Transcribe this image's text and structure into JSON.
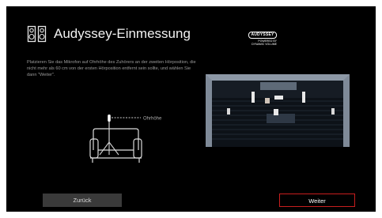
{
  "header": {
    "title": "Audyssey-Einmessung",
    "title_icon": "speaker-pair-icon"
  },
  "logo": {
    "brand": "AUDYSSEY",
    "line1": "POWERED BY",
    "line2": "DYNAMIC VOLUME"
  },
  "instruction": "Platzieren Sie das Mikrofon auf Ohrhöhe des Zuhörers an der zweiten Hörposition, die nicht mehr als 60 cm von der ersten Hörposition entfernt sein sollte, und wählen Sie dann \"Weiter\".",
  "illustration": {
    "ear_height_label": "Ohrhöhe",
    "icons": [
      "microphone-icon",
      "sofa-icon",
      "room-diagram"
    ]
  },
  "buttons": {
    "back": "Zurück",
    "next": "Weiter"
  },
  "colors": {
    "background": "#000000",
    "accent": "#c81e1e",
    "text": "#f2f2f2",
    "muted_text": "#9a9a9a",
    "room_wall": "#7f8a98"
  }
}
